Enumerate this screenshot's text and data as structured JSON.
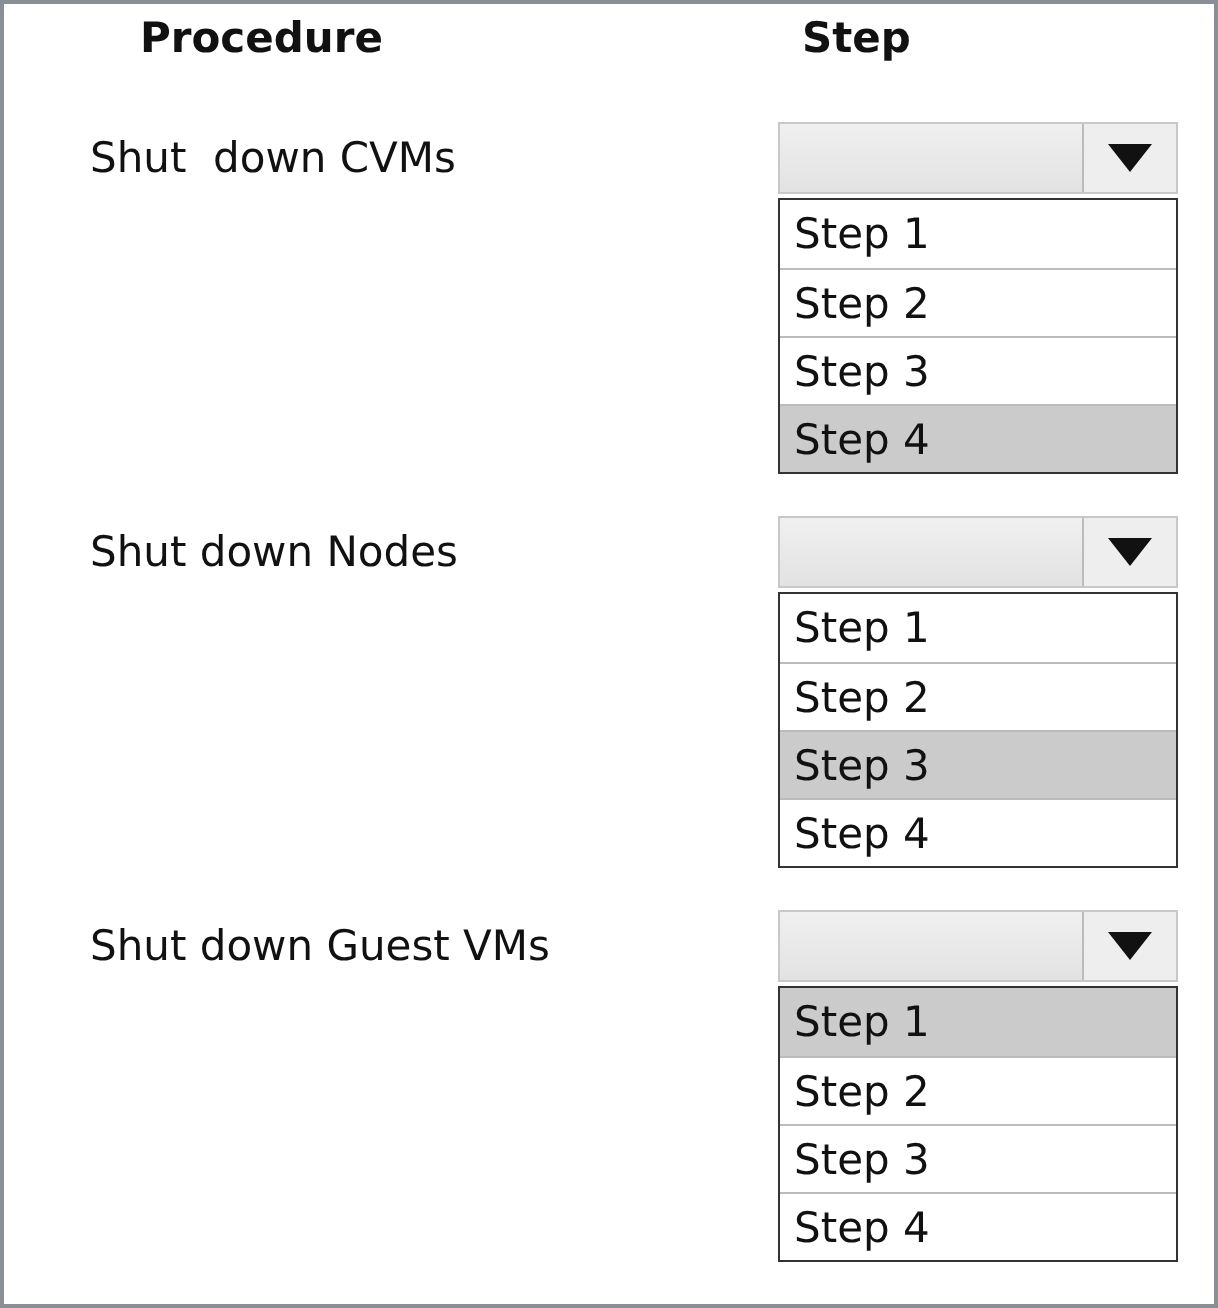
{
  "headers": {
    "procedure": "Procedure",
    "step": "Step"
  },
  "rows": [
    {
      "procedure": "Shut  down CVMs",
      "options": [
        {
          "label": "Step 1",
          "selected": false
        },
        {
          "label": "Step 2",
          "selected": false
        },
        {
          "label": "Step 3",
          "selected": false
        },
        {
          "label": "Step 4",
          "selected": true
        }
      ]
    },
    {
      "procedure": "Shut down Nodes",
      "options": [
        {
          "label": "Step 1",
          "selected": false
        },
        {
          "label": "Step 2",
          "selected": false
        },
        {
          "label": "Step 3",
          "selected": true
        },
        {
          "label": "Step 4",
          "selected": false
        }
      ]
    },
    {
      "procedure": "Shut down Guest VMs",
      "options": [
        {
          "label": "Step 1",
          "selected": true
        },
        {
          "label": "Step 2",
          "selected": false
        },
        {
          "label": "Step 3",
          "selected": false
        },
        {
          "label": "Step 4",
          "selected": false
        }
      ]
    }
  ]
}
